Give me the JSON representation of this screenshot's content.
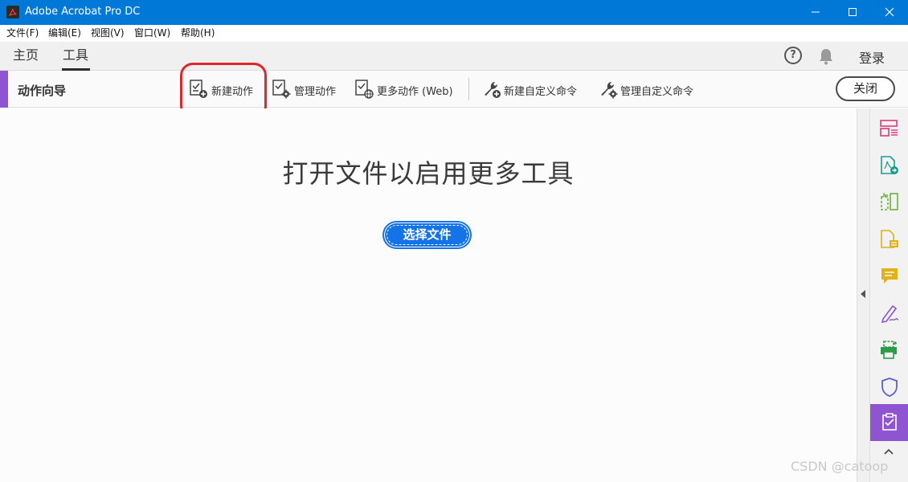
{
  "window": {
    "title": "Adobe Acrobat Pro DC"
  },
  "menubar": {
    "items": [
      "文件(F)",
      "编辑(E)",
      "视图(V)",
      "窗口(W)",
      "帮助(H)"
    ]
  },
  "tabs": {
    "items": [
      "主页",
      "工具"
    ],
    "active": "工具"
  },
  "header": {
    "help_label": "?",
    "login_label": "登录"
  },
  "toolbar": {
    "title": "动作向导",
    "items": [
      "新建动作",
      "管理动作",
      "更多动作 (Web)",
      "新建自定义命令",
      "管理自定义命令"
    ],
    "close_label": "关闭"
  },
  "main": {
    "heading": "打开文件以启用更多工具",
    "open_button_label": "选择文件"
  },
  "right_panel": {
    "icons": [
      "organize-pages-icon",
      "export-pdf-icon",
      "compress-pdf-icon",
      "create-pdf-icon",
      "comment-icon",
      "fill-sign-icon",
      "print-production-icon",
      "protect-icon",
      "action-wizard-icon"
    ],
    "active_icon": "action-wizard-icon"
  },
  "watermark": "CSDN @catoop",
  "colors": {
    "titlebar": "#0078d7",
    "accent_purple": "#8f54d1",
    "primary_blue": "#1473e6",
    "highlight_red": "#e0262b"
  }
}
